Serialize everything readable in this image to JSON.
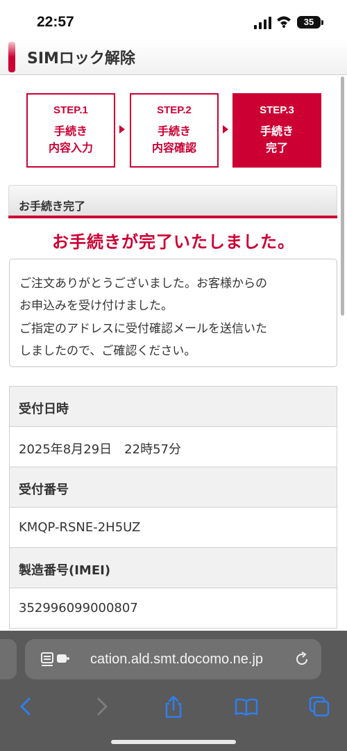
{
  "status_bar": {
    "time": "22:57",
    "battery": "35",
    "icons": [
      "signal-icon",
      "wifi-icon",
      "battery-icon"
    ]
  },
  "app": {
    "title": "SIMロック解除"
  },
  "steps": [
    {
      "label": "STEP.1",
      "text": "手続き\n内容入力",
      "active": false
    },
    {
      "label": "STEP.2",
      "text": "手続き\n内容確認",
      "active": false
    },
    {
      "label": "STEP.3",
      "text": "手続き\n完了",
      "active": true
    }
  ],
  "section": {
    "heading": "お手続き完了",
    "complete_message": "お手続きが完了いたしました。"
  },
  "message_lines": [
    "ご注文ありがとうございました。お客様からの",
    "お申込みを受け付けました。",
    "ご指定のアドレスに受付確認メールを送信いた",
    "しましたので、ご確認ください。"
  ],
  "info": {
    "reception_datetime_label": "受付日時",
    "reception_datetime_value": "2025年8月29日　22時57分",
    "reception_number_label": "受付番号",
    "reception_number_value": "KMQP-RSNE-2H5UZ",
    "imei_label": "製造番号(IMEI)",
    "imei_value": "352996099000807"
  },
  "browser": {
    "url": "cation.ald.smt.docomo.ne.jp",
    "toolbar_icons": [
      "back-icon",
      "forward-icon",
      "share-icon",
      "bookmarks-icon",
      "tabs-icon"
    ]
  },
  "colors": {
    "accent": "#cc0033",
    "browser_bg": "#5a5a5a",
    "icon_blue": "#2f7ff0"
  }
}
